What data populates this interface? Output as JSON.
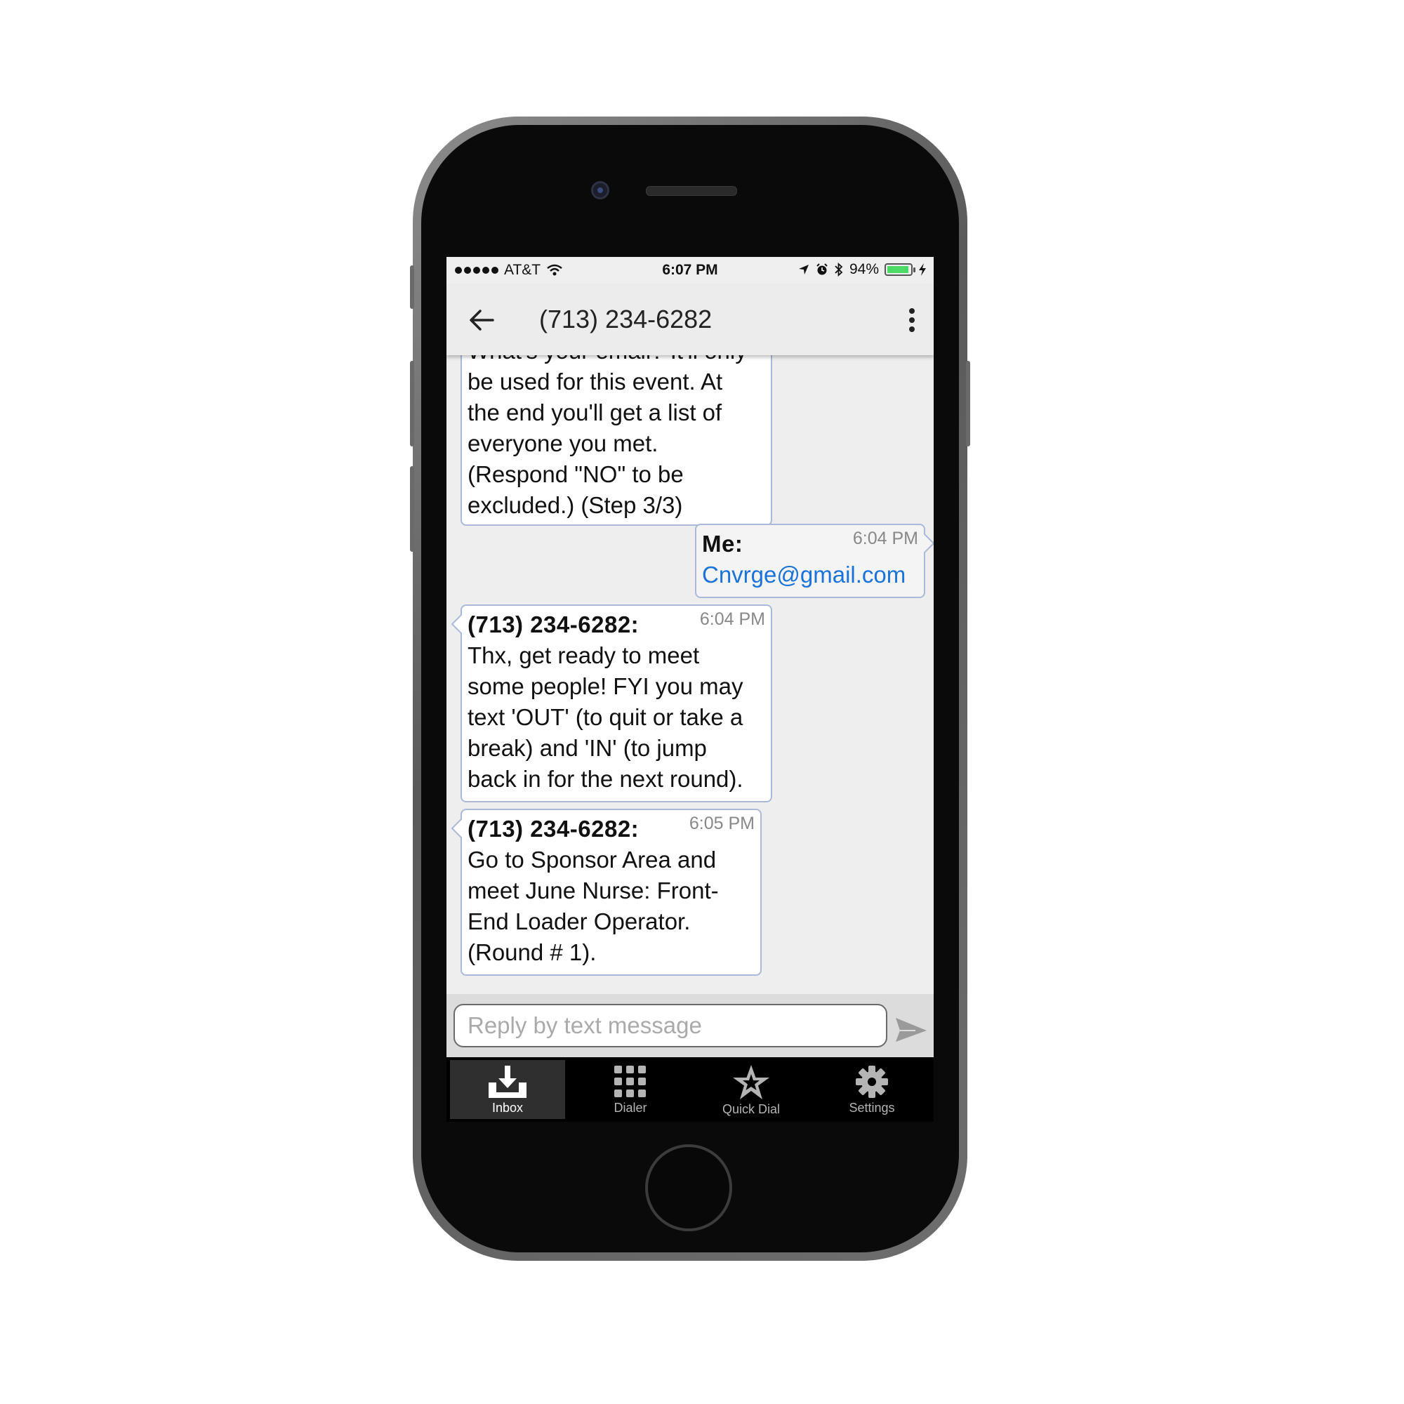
{
  "status_bar": {
    "carrier": "AT&T",
    "time": "6:07 PM",
    "battery_percent": "94%",
    "battery_level": 0.94,
    "battery_color": "#4cd964"
  },
  "header": {
    "title": "(713) 234-6282",
    "back_icon": "back-arrow-icon",
    "menu_icon": "more-vertical-icon"
  },
  "messages": [
    {
      "sender": "",
      "time": "",
      "lines": [
        "What's your email? It'll only",
        "be used for this event. At",
        "the end you'll get a list of",
        "everyone you met.",
        "(Respond \"NO\" to be",
        "excluded.) (Step 3/3)"
      ]
    },
    {
      "sender": "Me:",
      "time": "6:04 PM",
      "lines": [
        "Cnvrge@gmail.com"
      ]
    },
    {
      "sender": "(713) 234-6282:",
      "time": "6:04 PM",
      "lines": [
        "Thx, get ready to meet",
        "some people! FYI you may",
        "text 'OUT' (to quit or take a",
        "break) and 'IN' (to jump",
        "back in for the next round)."
      ]
    },
    {
      "sender": "(713) 234-6282:",
      "time": "6:05 PM",
      "lines": [
        "Go to Sponsor Area and",
        "meet June Nurse: Front-",
        "End Loader Operator.",
        "(Round # 1)."
      ]
    }
  ],
  "reply": {
    "placeholder": "Reply by text message",
    "value": "",
    "send_icon": "send-icon"
  },
  "tabs": [
    {
      "label": "Inbox",
      "icon": "inbox-download-icon",
      "active": true
    },
    {
      "label": "Dialer",
      "icon": "keypad-icon",
      "active": false
    },
    {
      "label": "Quick Dial",
      "icon": "star-icon",
      "active": false
    },
    {
      "label": "Settings",
      "icon": "gear-icon",
      "active": false
    }
  ],
  "colors": {
    "bubble_border": "#a9b9da",
    "link": "#1a73d9",
    "chat_background": "#eeeeee"
  }
}
